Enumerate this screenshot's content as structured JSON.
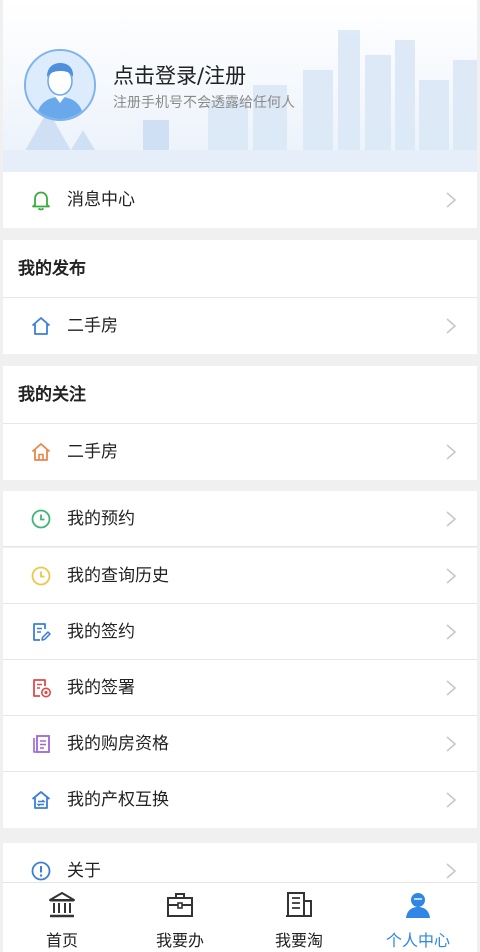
{
  "header": {
    "title": "点击登录/注册",
    "subtitle": "注册手机号不会透露给任何人"
  },
  "menu": {
    "messages": "消息中心",
    "my_posts": {
      "heading": "我的发布",
      "items": [
        "二手房"
      ]
    },
    "my_follows": {
      "heading": "我的关注",
      "items": [
        "二手房"
      ]
    },
    "services": [
      "我的预约",
      "我的查询历史",
      "我的签约",
      "我的签署",
      "我的购房资格",
      "我的产权互换"
    ],
    "about": "关于"
  },
  "tabbar": {
    "items": [
      {
        "label": "首页",
        "icon": "bank-icon"
      },
      {
        "label": "我要办",
        "icon": "briefcase-icon"
      },
      {
        "label": "我要淘",
        "icon": "building-icon"
      },
      {
        "label": "个人中心",
        "icon": "person-icon"
      }
    ],
    "active_index": 3,
    "active_color": "#2f86e6"
  },
  "colors": {
    "bell": "#3cab3c",
    "house_blue": "#3c7fd6",
    "house_orange": "#e8874a",
    "clock_green": "#3cb678",
    "clock_yellow": "#f0c54a",
    "sign_blue": "#3c7fd6",
    "seal_red": "#e04a4a",
    "doc_purple": "#a066d6"
  }
}
